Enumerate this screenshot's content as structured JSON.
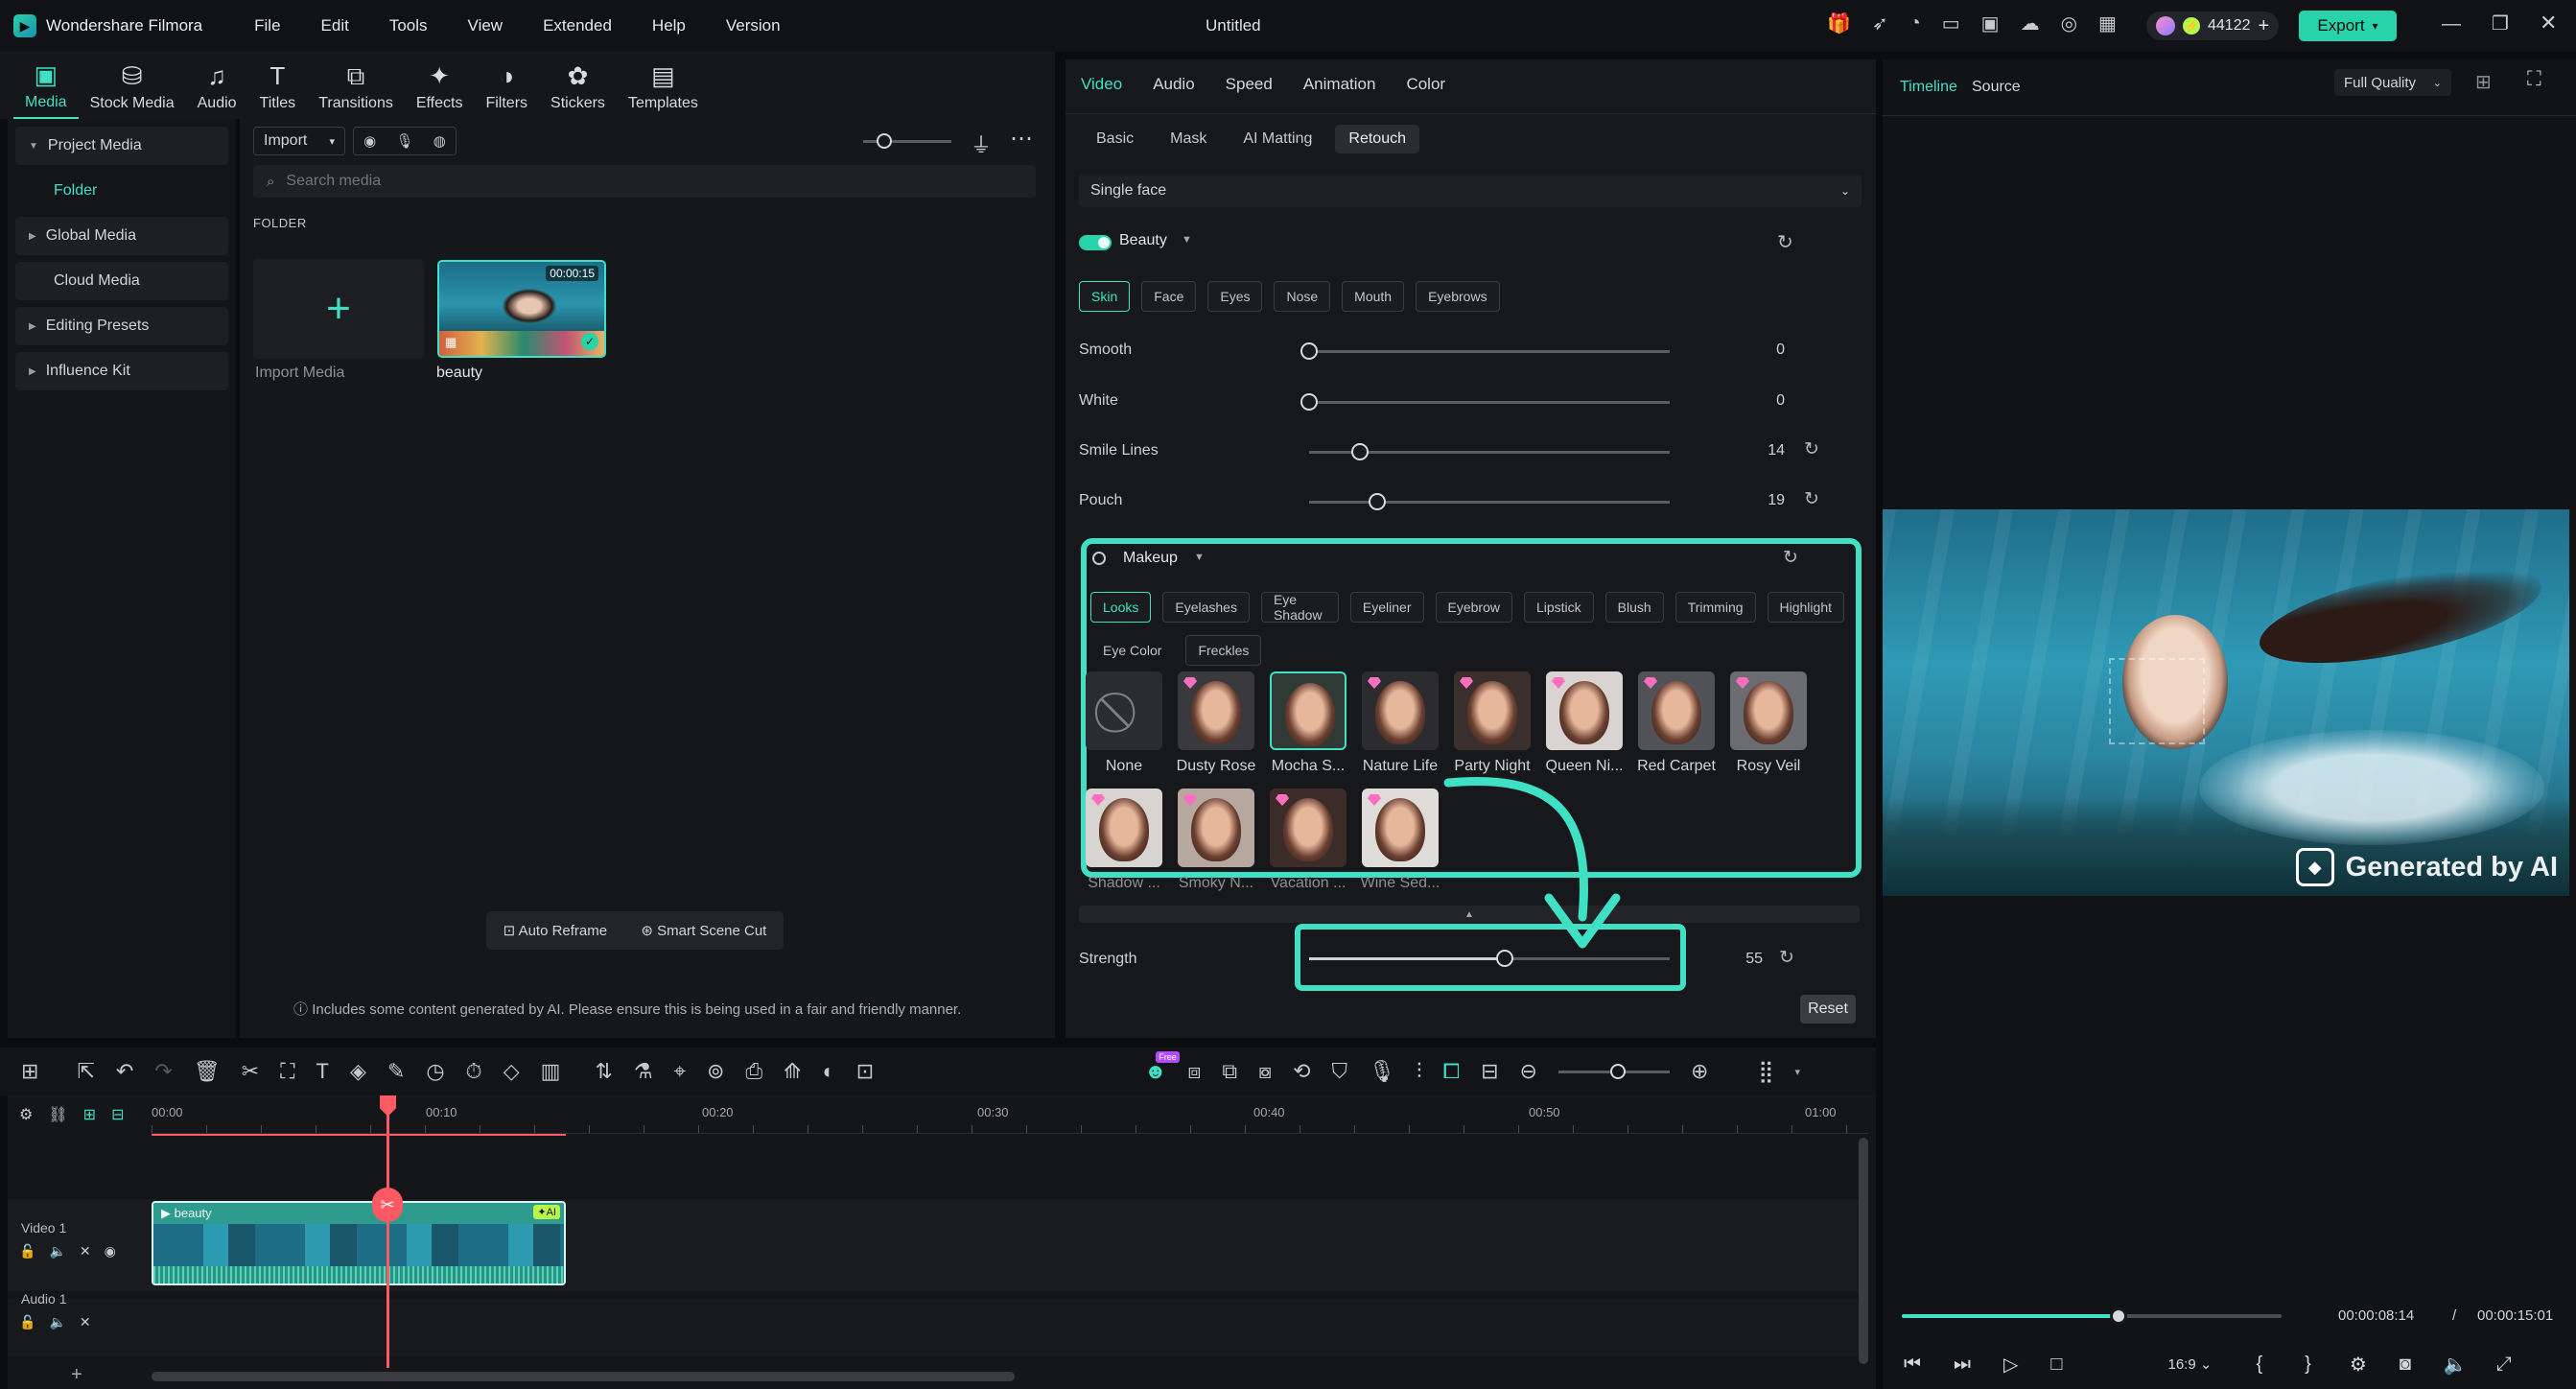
{
  "app": {
    "name": "Wondershare Filmora",
    "doc_title": "Untitled",
    "credits": "44122",
    "export_label": "Export"
  },
  "menu": [
    "File",
    "Edit",
    "Tools",
    "View",
    "Extended",
    "Help",
    "Version"
  ],
  "toolbar": [
    "Media",
    "Stock Media",
    "Audio",
    "Titles",
    "Transitions",
    "Effects",
    "Filters",
    "Stickers",
    "Templates"
  ],
  "sidebar": {
    "items": [
      "Project Media",
      "Folder",
      "Global Media",
      "Cloud Media",
      "Editing Presets",
      "Influence Kit"
    ]
  },
  "media": {
    "import_label": "Import",
    "search_placeholder": "Search media",
    "folder_heading": "FOLDER",
    "import_media_label": "Import Media",
    "clip_name": "beauty",
    "clip_duration": "00:00:15",
    "auto_reframe": "Auto Reframe",
    "smart_scene_cut": "Smart Scene Cut",
    "ai_notice": "Includes some content generated by AI. Please ensure this is being used in a fair and friendly manner."
  },
  "props": {
    "tabs": [
      "Video",
      "Audio",
      "Speed",
      "Animation",
      "Color"
    ],
    "subtabs": [
      "Basic",
      "Mask",
      "AI Matting",
      "Retouch"
    ],
    "face_select": "Single face",
    "beauty_label": "Beauty",
    "beauty_chips": [
      "Skin",
      "Face",
      "Eyes",
      "Nose",
      "Mouth",
      "Eyebrows"
    ],
    "sliders": [
      {
        "label": "Smooth",
        "value": 0
      },
      {
        "label": "White",
        "value": 0
      },
      {
        "label": "Smile Lines",
        "value": 14
      },
      {
        "label": "Pouch",
        "value": 19
      }
    ],
    "makeup_label": "Makeup",
    "makeup_chips": [
      "Looks",
      "Eyelashes",
      "Eye Shadow",
      "Eyeliner",
      "Eyebrow",
      "Lipstick",
      "Blush",
      "Trimming",
      "Highlight",
      "Eye Color",
      "Freckles"
    ],
    "looks_row1": [
      "None",
      "Dusty Rose",
      "Mocha S...",
      "Nature Life",
      "Party Night",
      "Queen Ni...",
      "Red Carpet",
      "Rosy Veil"
    ],
    "looks_row2": [
      "Shadow ...",
      "Smoky N...",
      "Vacation ...",
      "Wine Sed..."
    ],
    "strength_label": "Strength",
    "strength_value": 55,
    "reset_label": "Reset"
  },
  "preview": {
    "tabs": [
      "Timeline",
      "Source"
    ],
    "quality": "Full Quality",
    "watermark": "Generated by AI",
    "current_time": "00:00:08:14",
    "separator": "/",
    "total_time": "00:00:15:01",
    "aspect": "16:9",
    "progress": 0.57
  },
  "timeline": {
    "ticks": [
      "00:00",
      "00:10",
      "00:20",
      "00:30",
      "00:40",
      "00:50",
      "01:00"
    ],
    "track_video": "Video 1",
    "track_audio": "Audio 1",
    "clip_label": "beauty",
    "ai_badge": "AI",
    "free_badge": "Free"
  },
  "colors": {
    "accent": "#3fe0c4",
    "playhead": "#ff5a63",
    "export": "#27d3a8"
  }
}
